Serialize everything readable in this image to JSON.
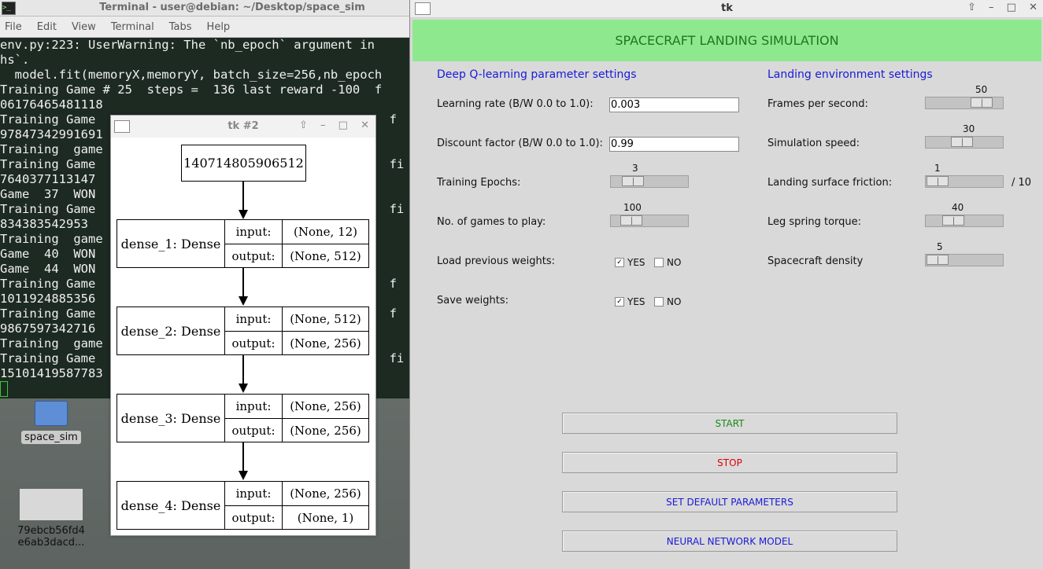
{
  "terminal": {
    "title": "Terminal - user@debian: ~/Desktop/space_sim",
    "menu": [
      "File",
      "Edit",
      "View",
      "Terminal",
      "Tabs",
      "Help"
    ],
    "lines": [
      "env.py:223: UserWarning: The `nb_epoch` argument in ",
      "hs`.",
      "  model.fit(memoryX,memoryY, batch_size=256,nb_epoch",
      "Training Game # 25  steps =  136 last reward -100  f",
      "06176465481118",
      "Training Game                                     0  f",
      "97847342991691",
      "Training  game",
      "Training Game                                        fi",
      "7640377113147",
      "Game  37  WON",
      "Training Game                                        fi",
      "834383542953",
      "Training  game",
      "Game  40  WON",
      "Game  44  WON",
      "Training Game                                     0  f",
      "1011924885356",
      "Training Game                                     0  f",
      "9867597342716",
      "Training  game",
      "Training Game                                        fi",
      "15101419587783"
    ]
  },
  "desktop": {
    "icons": [
      {
        "label": "space_sim",
        "icon": "folder-icon"
      },
      {
        "label_lines": [
          "79ebcb56fd4",
          "e6ab3dacd..."
        ],
        "icon": "image-thumbnail-icon"
      }
    ]
  },
  "tk2": {
    "title": "tk #2",
    "top_node": "140714805906512",
    "layers": [
      {
        "name": "dense_1: Dense",
        "input_label": "input:",
        "input_shape": "(None, 12)",
        "output_label": "output:",
        "output_shape": "(None, 512)"
      },
      {
        "name": "dense_2: Dense",
        "input_label": "input:",
        "input_shape": "(None, 512)",
        "output_label": "output:",
        "output_shape": "(None, 256)"
      },
      {
        "name": "dense_3: Dense",
        "input_label": "input:",
        "input_shape": "(None, 256)",
        "output_label": "output:",
        "output_shape": "(None, 256)"
      },
      {
        "name": "dense_4: Dense",
        "input_label": "input:",
        "input_shape": "(None, 256)",
        "output_label": "output:",
        "output_shape": "(None, 1)"
      }
    ]
  },
  "tk": {
    "title": "tk",
    "banner": "SPACECRAFT LANDING SIMULATION",
    "left_section": "Deep Q-learning parameter settings",
    "right_section": "Landing environment settings",
    "learning_rate": {
      "label": "Learning rate (B/W 0.0 to 1.0):",
      "value": "0.003"
    },
    "discount_factor": {
      "label": "Discount factor (B/W 0.0 to 1.0):",
      "value": "0.99"
    },
    "training_epochs": {
      "label": "Training Epochs:",
      "value": "3",
      "level": 0.2
    },
    "games_to_play": {
      "label": "No. of games to play:",
      "value": "100",
      "level": 0.17
    },
    "load_weights": {
      "label": "Load previous weights:",
      "yes": "YES",
      "no": "NO",
      "yes_checked": true
    },
    "save_weights": {
      "label": "Save weights:",
      "yes": "YES",
      "no": "NO",
      "yes_checked": true
    },
    "fps": {
      "label": "Frames per second:",
      "value": "50",
      "level": 0.82
    },
    "sim_speed": {
      "label": "Simulation speed:",
      "value": "30",
      "level": 0.45
    },
    "friction": {
      "label": "Landing surface friction:",
      "value": "1",
      "suffix": "/ 10",
      "level": 0.02
    },
    "leg_torque": {
      "label": "Leg spring torque:",
      "value": "40",
      "level": 0.3
    },
    "density": {
      "label": "Spacecraft density",
      "value": "5",
      "level": 0.02
    },
    "buttons": {
      "start": "START",
      "stop": "STOP",
      "defaults": "SET DEFAULT PARAMETERS",
      "nn_model": "NEURAL NETWORK MODEL"
    },
    "colors": {
      "banner_bg": "#8ee98e",
      "banner_text": "#1a7a1a",
      "section": "#1a1ad8",
      "start": "#1a8a1a",
      "stop": "#e00000",
      "nav": "#1a1ad8"
    }
  }
}
